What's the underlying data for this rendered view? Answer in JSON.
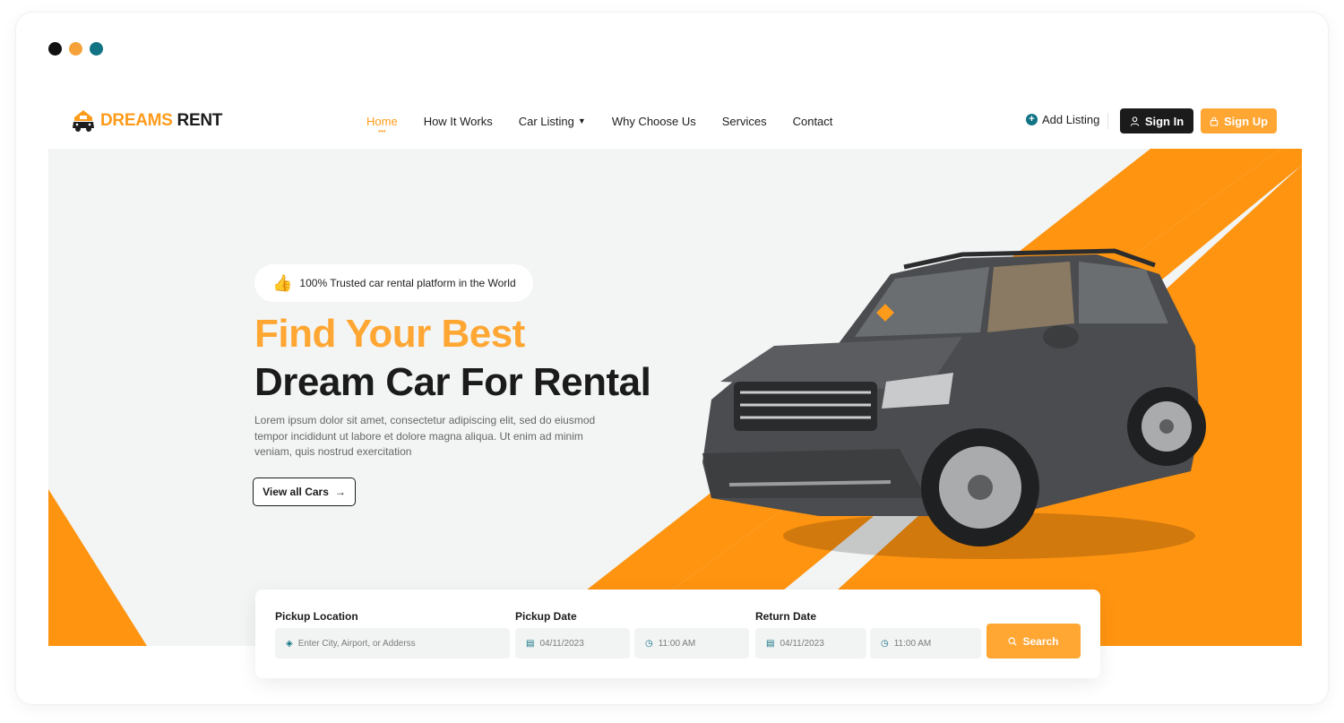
{
  "window": {
    "dot_colors": [
      "#111111",
      "#f6a23a",
      "#127384"
    ]
  },
  "brand": {
    "word1": "DREAMS",
    "word2": "RENT",
    "accent": "#ff9b1b"
  },
  "nav": {
    "items": [
      {
        "label": "Home",
        "active": true
      },
      {
        "label": "How It Works"
      },
      {
        "label": "Car Listing",
        "caret": true
      },
      {
        "label": "Why Choose Us"
      },
      {
        "label": "Services"
      },
      {
        "label": "Contact"
      }
    ]
  },
  "header_actions": {
    "add_listing": "Add Listing",
    "sign_in": "Sign In",
    "sign_up": "Sign Up"
  },
  "hero": {
    "badge": "100% Trusted car rental platform in the World",
    "title_line1": "Find Your Best",
    "title_line2": "Dream Car For Rental",
    "lead": "Lorem ipsum dolor sit amet, consectetur adipiscing elit, sed do eiusmod tempor incididunt ut labore et dolore magna aliqua. Ut enim ad minim veniam, quis nostrud exercitation",
    "cta": "View all Cars"
  },
  "search": {
    "pickup_location_label": "Pickup Location",
    "pickup_location_placeholder": "Enter City, Airport, or Adderss",
    "pickup_date_label": "Pickup Date",
    "pickup_date": "04/11/2023",
    "pickup_time": "11:00 AM",
    "return_date_label": "Return Date",
    "return_date": "04/11/2023",
    "return_time": "11:00 AM",
    "button": "Search"
  },
  "colors": {
    "orange": "#ff9410",
    "teal": "#127384",
    "dark": "#1b1b1b",
    "bg": "#f2f5f4"
  }
}
